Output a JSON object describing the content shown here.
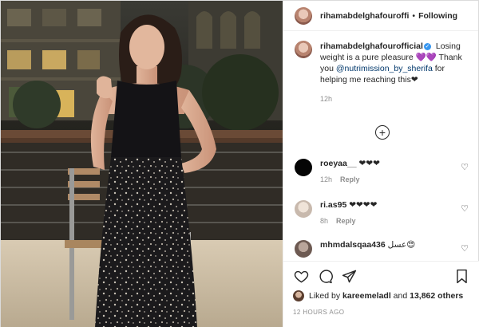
{
  "header": {
    "username": "rihamabdelghafouroffi",
    "separator": "•",
    "follow_state": "Following"
  },
  "caption": {
    "username": "rihamabdelghafourofficial",
    "text_before_mention": "Losing weight is a pure pleasure 💜💜 Thank you",
    "mention": "@nutrimission_by_sherifa",
    "text_after_mention": "for helping me reaching this❤",
    "time": "12h"
  },
  "comments": [
    {
      "username": "roeyaa__",
      "text": "❤❤❤",
      "time": "12h",
      "reply": "Reply"
    },
    {
      "username": "ri.as95",
      "text": "❤❤❤❤",
      "time": "8h",
      "reply": "Reply"
    },
    {
      "username": "mhmdalsqaa436",
      "text": "عسل😍",
      "time": "",
      "reply": ""
    }
  ],
  "likes": {
    "prefix": "Liked by",
    "user": "kareemeladl",
    "suffix": "and",
    "count": "13,862 others"
  },
  "post_time": "12 HOURS AGO",
  "icons": {
    "like": "heart-outline-icon",
    "comment": "comment-icon",
    "share": "paper-plane-icon",
    "save": "bookmark-icon",
    "load_more": "plus-circle-icon"
  },
  "colors": {
    "verified": "#3897f0",
    "mention": "#00376b",
    "meta": "#8e8e8e",
    "text": "#262626"
  }
}
